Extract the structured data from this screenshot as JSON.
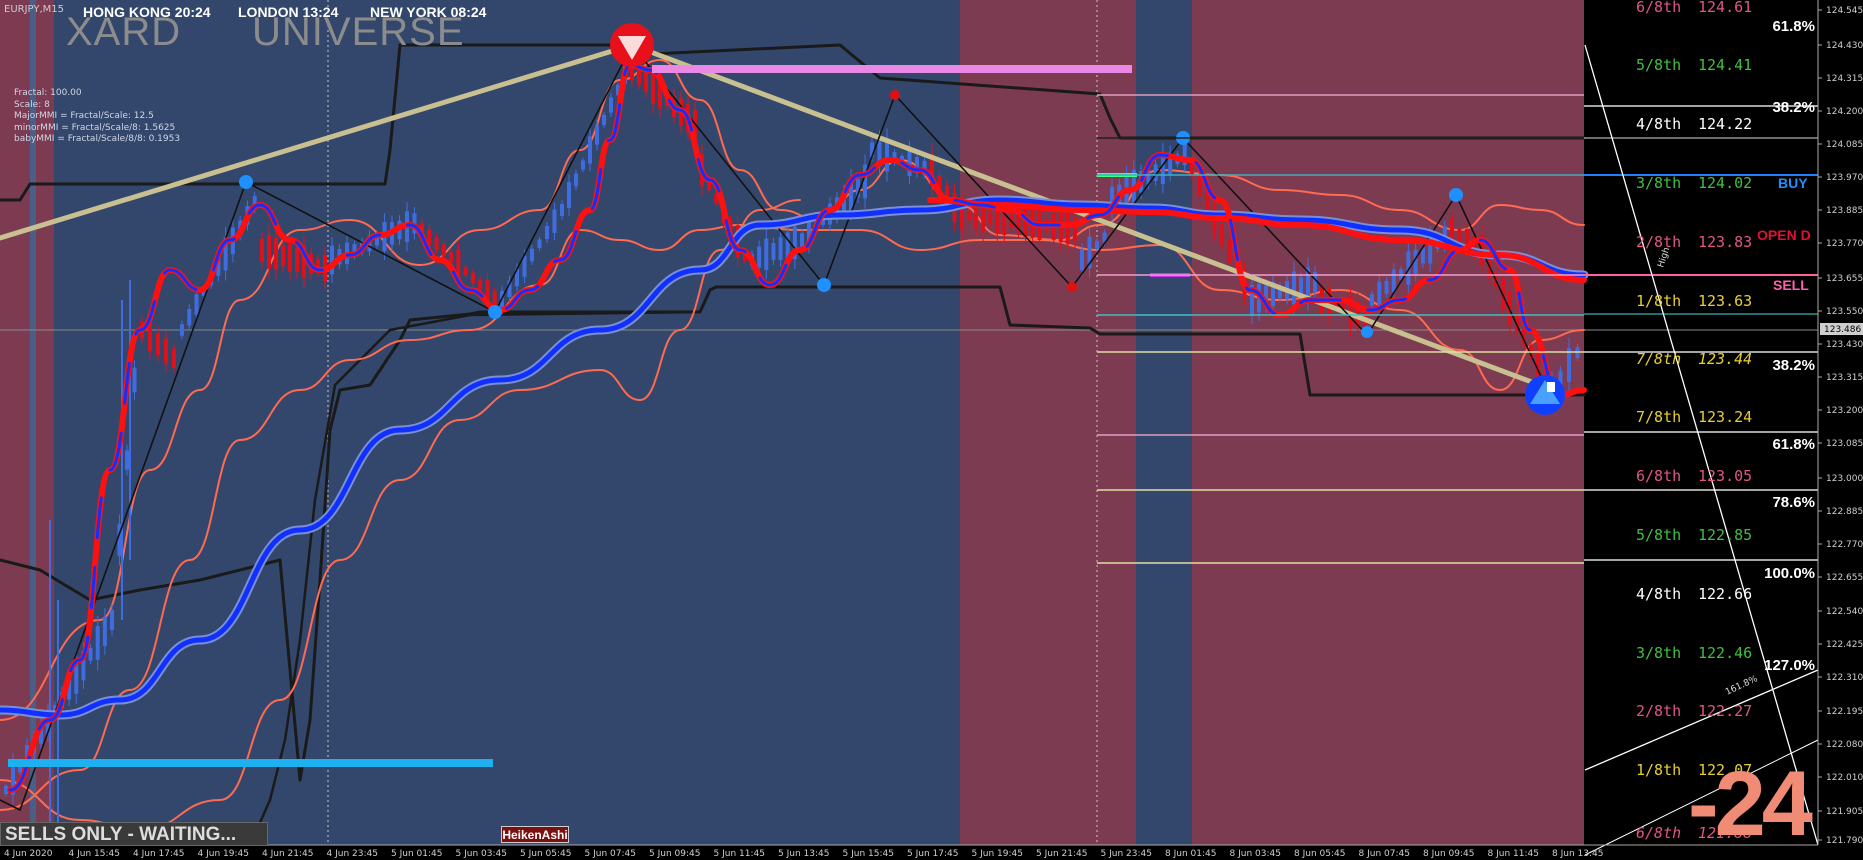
{
  "window": {
    "symbol": "EURJPY,M15"
  },
  "clocks": [
    {
      "label": "HONG KONG 20:24",
      "bg": "#b3202a"
    },
    {
      "label": "LONDON  13:24",
      "bg": "#1f7bd6"
    },
    {
      "label": "NEW YORK  08:24",
      "bg": "#1f7bd6"
    }
  ],
  "brand": {
    "left": "XARD",
    "right": "UNIVERSE"
  },
  "fractal_info": [
    "Fractal: 100.00",
    "Scale: 8",
    "MajorMMI = Fractal/Scale: 12.5",
    "minorMMI = Fractal/Scale/8: 1.5625",
    " babyMMI = Fractal/Scale/8/8: 0.1953"
  ],
  "status": "SELLS ONLY - WAITING...",
  "heiken_button": "HeikenAshi",
  "big_number": "-24",
  "colors": {
    "bg_red": "#7d3b52",
    "bg_blue": "#33476c",
    "panel": "#000000",
    "bull": "#3f6de0",
    "bear": "#e0101a",
    "ma_blue": "#1030ff",
    "ma_red": "#ff1010",
    "band": "#ff6a50",
    "envelope": "#1a1a1a",
    "trend": "#c8c090"
  },
  "price_axis": {
    "labels": [
      "124.545",
      "124.430",
      "124.315",
      "124.200",
      "124.085",
      "123.970",
      "123.885",
      "123.770",
      "123.655",
      "123.550",
      "123.430",
      "123.315",
      "123.200",
      "123.085",
      "123.000",
      "122.885",
      "122.770",
      "122.655",
      "122.540",
      "122.425",
      "122.310",
      "122.195",
      "122.080",
      "122.010",
      "121.905",
      "121.790"
    ],
    "current": "123.486"
  },
  "time_axis": [
    "4 Jun 2020",
    "4 Jun 15:45",
    "4 Jun 17:45",
    "4 Jun 19:45",
    "4 Jun 21:45",
    "4 Jun 23:45",
    "5 Jun 01:45",
    "5 Jun 03:45",
    "5 Jun 05:45",
    "5 Jun 07:45",
    "5 Jun 09:45",
    "5 Jun 11:45",
    "5 Jun 13:45",
    "5 Jun 15:45",
    "5 Jun 17:45",
    "5 Jun 19:45",
    "5 Jun 21:45",
    "5 Jun 23:45",
    "8 Jun 01:45",
    "8 Jun 03:45",
    "8 Jun 05:45",
    "8 Jun 07:45",
    "8 Jun 09:45",
    "8 Jun 11:45",
    "8 Jun 13:45"
  ],
  "murrey": [
    {
      "label": "6/8th",
      "price": "124.61",
      "color": "#e0568a"
    },
    {
      "label": "5/8th",
      "price": "124.41",
      "color": "#3fc03f"
    },
    {
      "label": "4/8th",
      "price": "124.22",
      "color": "#ffffff"
    },
    {
      "label": "3/8th",
      "price": "124.02",
      "color": "#3fc03f"
    },
    {
      "label": "2/8th",
      "price": "123.83",
      "color": "#e0568a"
    },
    {
      "label": "1/8th",
      "price": "123.63",
      "color": "#e8d030"
    },
    {
      "label": "7/8th",
      "price": "123.44",
      "color": "#e8d030"
    },
    {
      "label": "7/8th",
      "price": "123.24",
      "color": "#e8d030"
    },
    {
      "label": "6/8th",
      "price": "123.05",
      "color": "#e0568a"
    },
    {
      "label": "5/8th",
      "price": "122.85",
      "color": "#3fc03f"
    },
    {
      "label": "4/8th",
      "price": "122.66",
      "color": "#ffffff"
    },
    {
      "label": "3/8th",
      "price": "122.46",
      "color": "#3fc03f"
    },
    {
      "label": "2/8th",
      "price": "122.27",
      "color": "#e0568a"
    },
    {
      "label": "1/8th",
      "price": "122.07",
      "color": "#e8d030"
    },
    {
      "label": "6/8th",
      "price": "121.88",
      "color": "#e0568a"
    }
  ],
  "fibo": [
    "61.8%",
    "38.2%",
    "38.2%",
    "61.8%",
    "78.6%",
    "100.0%",
    "127.0%"
  ],
  "signals": {
    "buy": "BUY",
    "open": "OPEN D",
    "sell": "SELL",
    "fibo_small": "161.8%",
    "high": "High"
  }
}
